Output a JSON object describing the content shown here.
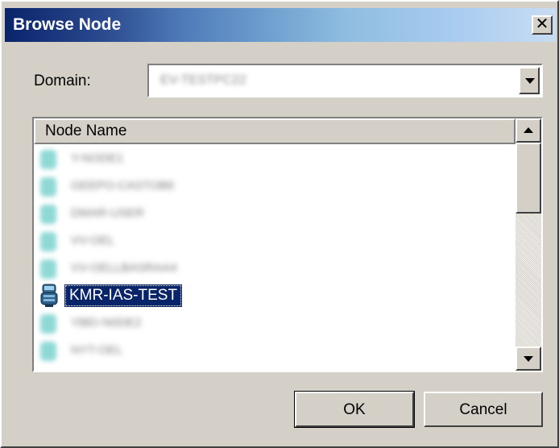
{
  "dialog": {
    "title": "Browse Node",
    "close_label": "✕"
  },
  "domain": {
    "label": "Domain:",
    "value": "EV-TESTPC22"
  },
  "list": {
    "column_header": "Node Name",
    "items": [
      {
        "label": "Y-NODE1",
        "selected": false
      },
      {
        "label": "GEEPO-CASTOB6",
        "selected": false
      },
      {
        "label": "DMAR-USER",
        "selected": false
      },
      {
        "label": "VV-OEL",
        "selected": false
      },
      {
        "label": "VV-OELLBASRAA4",
        "selected": false
      },
      {
        "label": "KMR-IAS-TEST",
        "selected": true
      },
      {
        "label": "YBEI-N0DE2",
        "selected": false
      },
      {
        "label": "NYT-OEL",
        "selected": false
      }
    ]
  },
  "buttons": {
    "ok": "OK",
    "cancel": "Cancel"
  },
  "colors": {
    "face": "#d4d0c8",
    "selection": "#0a246a",
    "title_start": "#0a246a",
    "title_end": "#a6caf0"
  }
}
